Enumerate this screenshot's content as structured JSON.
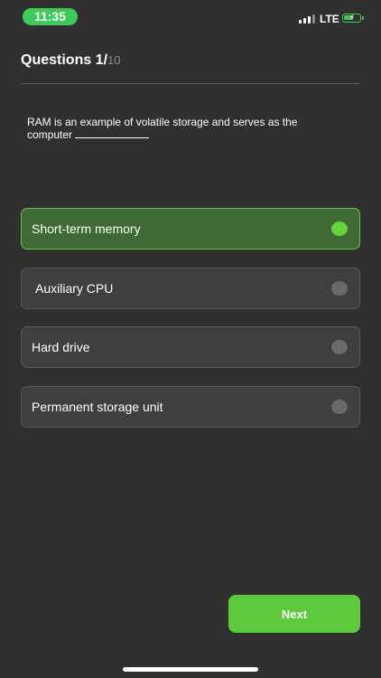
{
  "status_bar": {
    "time": "11:35",
    "network": "LTE",
    "signal_bars_active": 3,
    "battery_icon": "battery-charging-icon",
    "colors": {
      "accent": "#3ec95a"
    }
  },
  "quiz": {
    "heading": "Questions 1/",
    "question_total": "10",
    "question_text": "RAM is an example of volatile storage and serves as the computer",
    "options": [
      {
        "label": "Short-term memory",
        "selected": true
      },
      {
        "label": "Auxiliary CPU",
        "selected": false
      },
      {
        "label": "Hard drive",
        "selected": false
      },
      {
        "label": "Permanent storage unit",
        "selected": false
      }
    ],
    "next_label": "Next"
  },
  "colors": {
    "background": "#303030",
    "selected_option": "#3f6a35",
    "selected_radio": "#64d33e",
    "next_button": "#5dc93c"
  }
}
